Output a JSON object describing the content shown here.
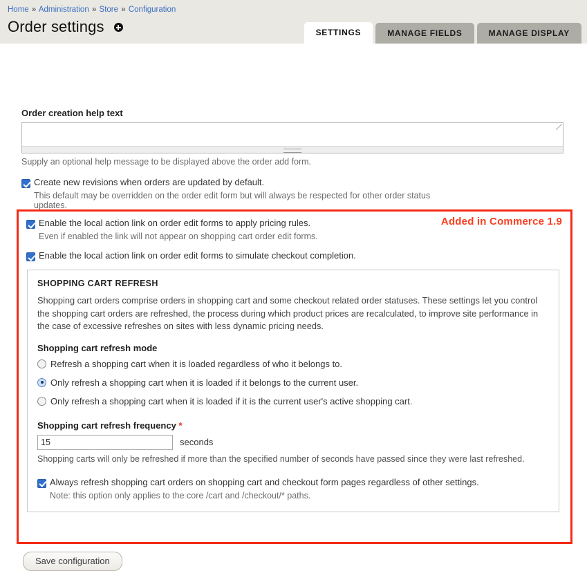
{
  "breadcrumb": {
    "items": [
      "Home",
      "Administration",
      "Store",
      "Configuration"
    ],
    "separator": "»"
  },
  "header": {
    "title": "Order settings",
    "add_icon": "plus-circle-icon"
  },
  "tabs": [
    {
      "label": "SETTINGS",
      "active": true
    },
    {
      "label": "MANAGE FIELDS",
      "active": false
    },
    {
      "label": "MANAGE DISPLAY",
      "active": false
    }
  ],
  "help_text_field": {
    "label": "Order creation help text",
    "value": "",
    "description": "Supply an optional help message to be displayed above the order add form."
  },
  "revisions": {
    "label": "Create new revisions when orders are updated by default.",
    "checked": true,
    "note": "This default may be overridden on the order edit form but will always be respected for other order status updates."
  },
  "highlight": {
    "badge": "Added in Commerce 1.9",
    "badge_color": "#fa3f20",
    "border_color": "#f52a16"
  },
  "pricing_rules": {
    "label": "Enable the local action link on order edit forms to apply pricing rules.",
    "checked": true,
    "note": "Even if enabled the link will not appear on shopping cart order edit forms."
  },
  "simulate_checkout": {
    "label": "Enable the local action link on order edit forms to simulate checkout completion.",
    "checked": true
  },
  "shopping_cart_refresh": {
    "legend": "SHOPPING CART REFRESH",
    "description": "Shopping cart orders comprise orders in shopping cart and some checkout related order statuses. These settings let you control the shopping cart orders are refreshed, the process during which product prices are recalculated, to improve site performance in the case of excessive refreshes on sites with less dynamic pricing needs.",
    "mode": {
      "label": "Shopping cart refresh mode",
      "options": [
        {
          "label": "Refresh a shopping cart when it is loaded regardless of who it belongs to.",
          "selected": false
        },
        {
          "label": "Only refresh a shopping cart when it is loaded if it belongs to the current user.",
          "selected": true
        },
        {
          "label": "Only refresh a shopping cart when it is loaded if it is the current user's active shopping cart.",
          "selected": false
        }
      ]
    },
    "frequency": {
      "label": "Shopping cart refresh frequency",
      "required_marker": "*",
      "value": "15",
      "unit": "seconds",
      "description": "Shopping carts will only be refreshed if more than the specified number of seconds have passed since they were last refreshed."
    },
    "always_refresh": {
      "label": "Always refresh shopping cart orders on shopping cart and checkout form pages regardless of other settings.",
      "checked": true,
      "note": "Note: this option only applies to the core /cart and /checkout/* paths."
    }
  },
  "save": {
    "label": "Save configuration"
  }
}
